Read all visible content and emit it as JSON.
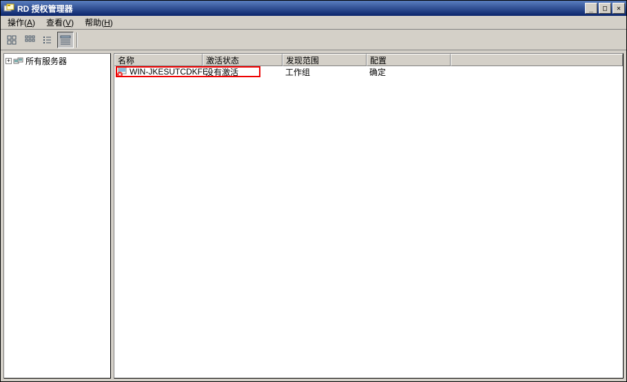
{
  "window": {
    "title": "RD 授权管理器"
  },
  "menu": {
    "action": {
      "label": "操作",
      "accel": "A"
    },
    "view": {
      "label": "查看",
      "accel": "V"
    },
    "help": {
      "label": "帮助",
      "accel": "H"
    }
  },
  "tree": {
    "root": {
      "label": "所有服务器",
      "expanded": false
    }
  },
  "list": {
    "columns": {
      "name": "名称",
      "activation": "激活状态",
      "scope": "发现范围",
      "config": "配置"
    },
    "rows": [
      {
        "name": "WIN-JKESUTCDKFE",
        "activation": "没有激活",
        "scope": "工作组",
        "config": "确定"
      }
    ]
  }
}
